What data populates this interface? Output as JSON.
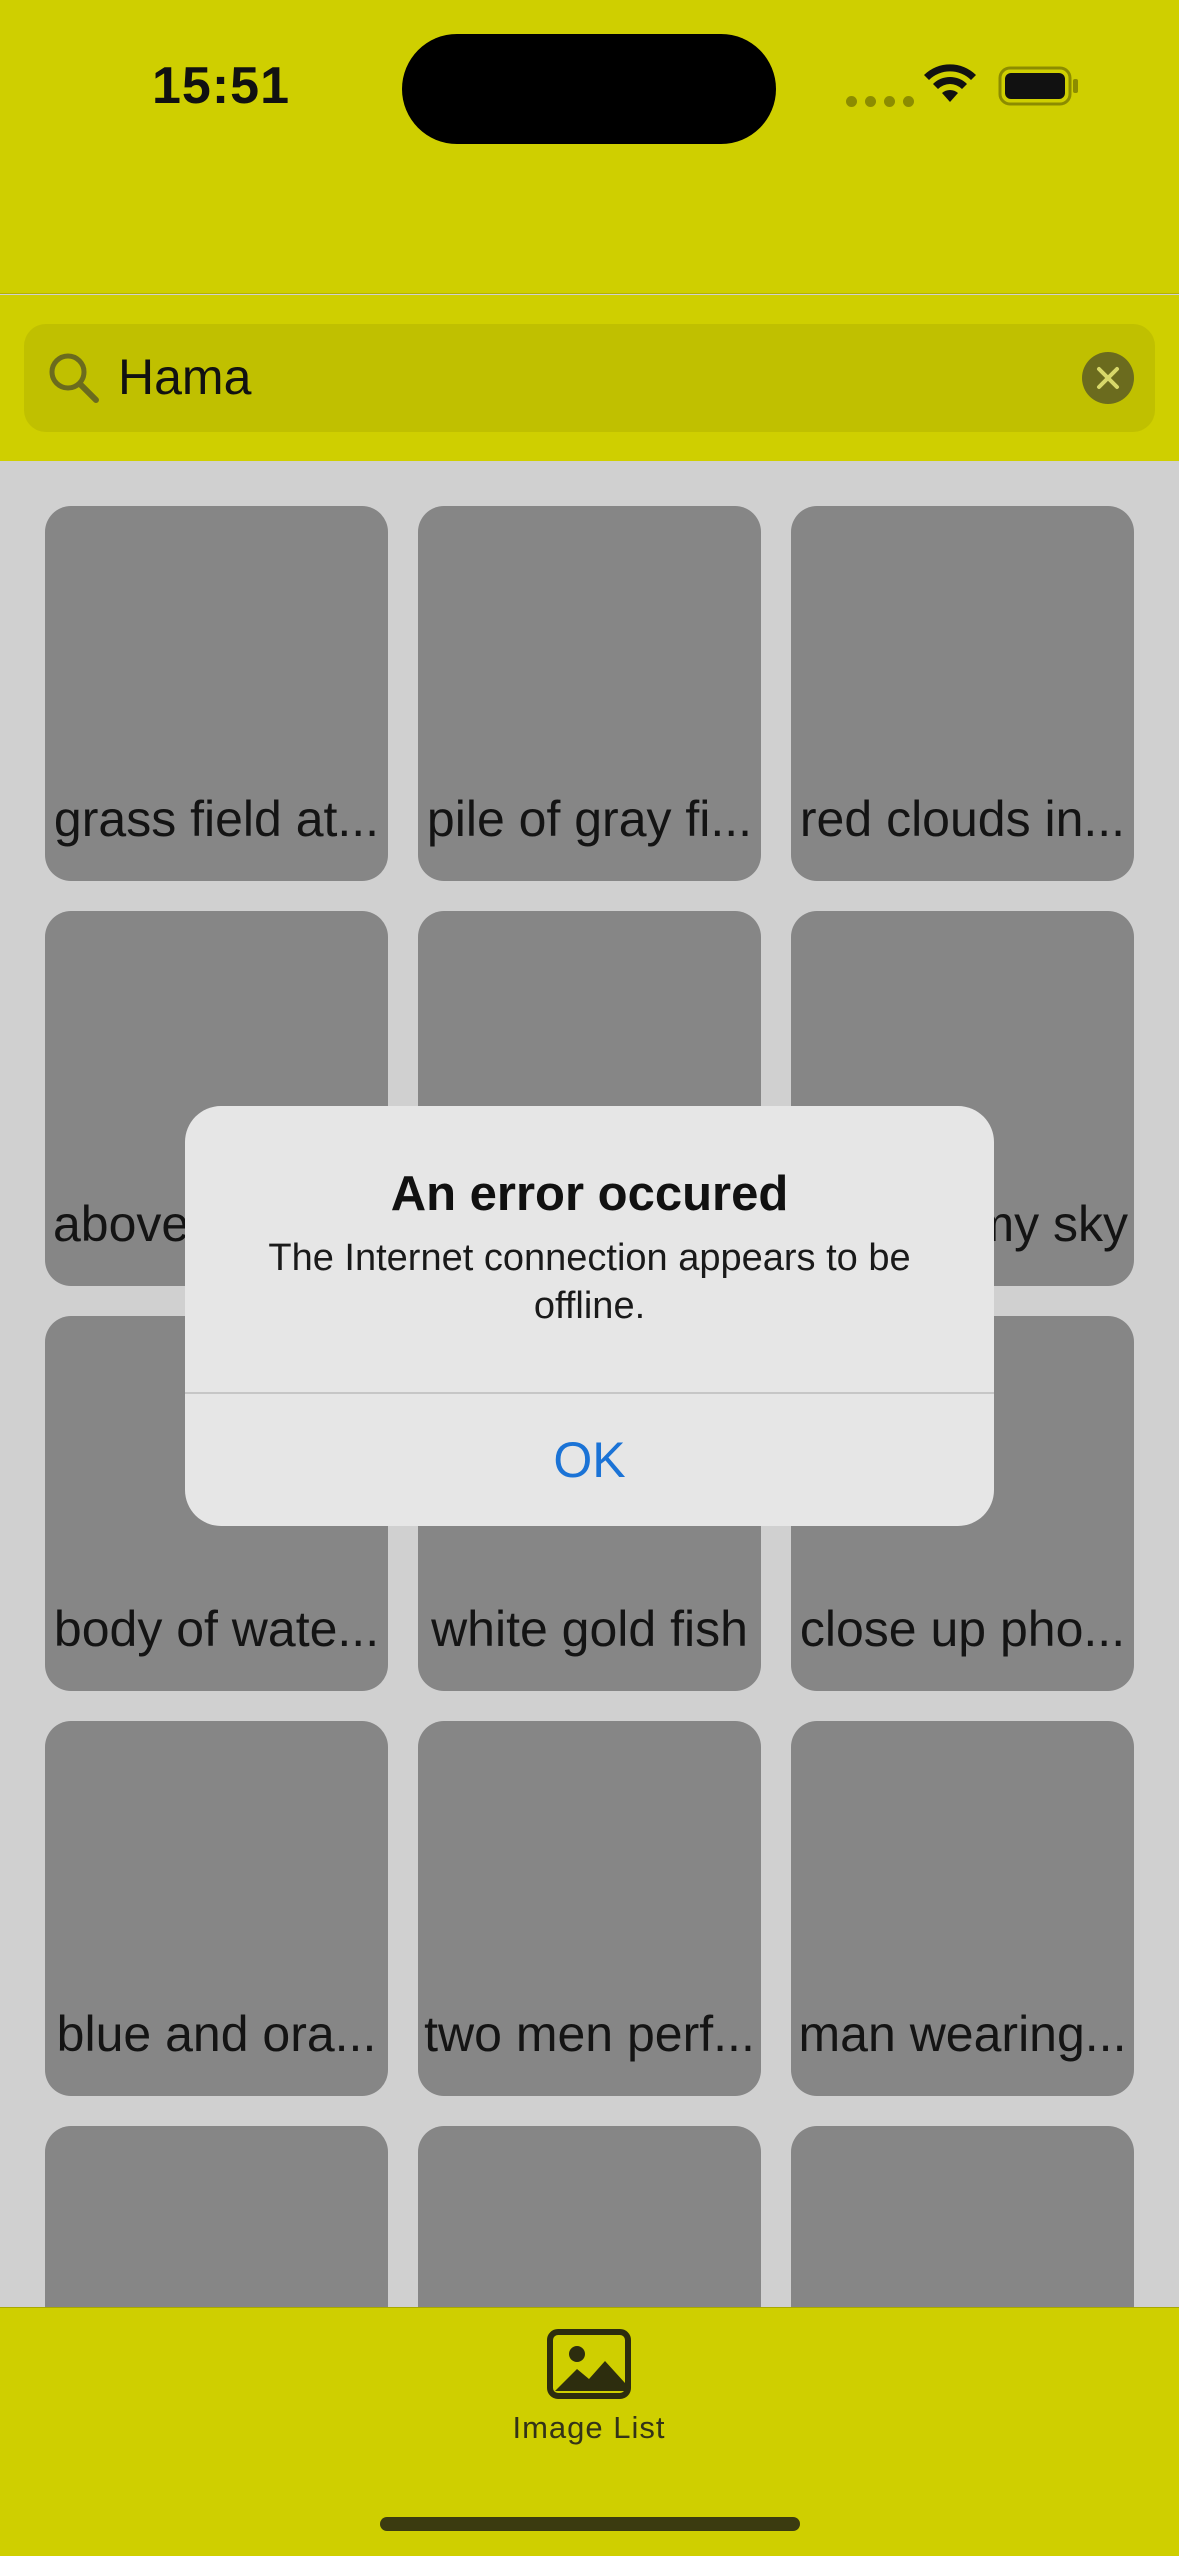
{
  "status_bar": {
    "time": "15:51"
  },
  "search": {
    "value": "Hama",
    "placeholder": ""
  },
  "grid": {
    "items": [
      {
        "label": "grass field at..."
      },
      {
        "label": "pile of gray fi..."
      },
      {
        "label": "red clouds in..."
      },
      {
        "label": "above"
      },
      {
        "label": ""
      },
      {
        "label": "my sky"
      },
      {
        "label": "body of wate..."
      },
      {
        "label": "white gold fish"
      },
      {
        "label": "close up pho..."
      },
      {
        "label": "blue and ora..."
      },
      {
        "label": "two men perf..."
      },
      {
        "label": "man wearing..."
      },
      {
        "label": ""
      },
      {
        "label": ""
      },
      {
        "label": ""
      }
    ]
  },
  "alert": {
    "title": "An error occured",
    "message": "The Internet connection appears to be offline.",
    "ok_label": "OK"
  },
  "tabbar": {
    "items": [
      {
        "label": "Image List",
        "icon": "photo-icon"
      }
    ]
  },
  "colors": {
    "accent_yellow": "#cfcf00",
    "link_blue": "#1b73d6"
  }
}
